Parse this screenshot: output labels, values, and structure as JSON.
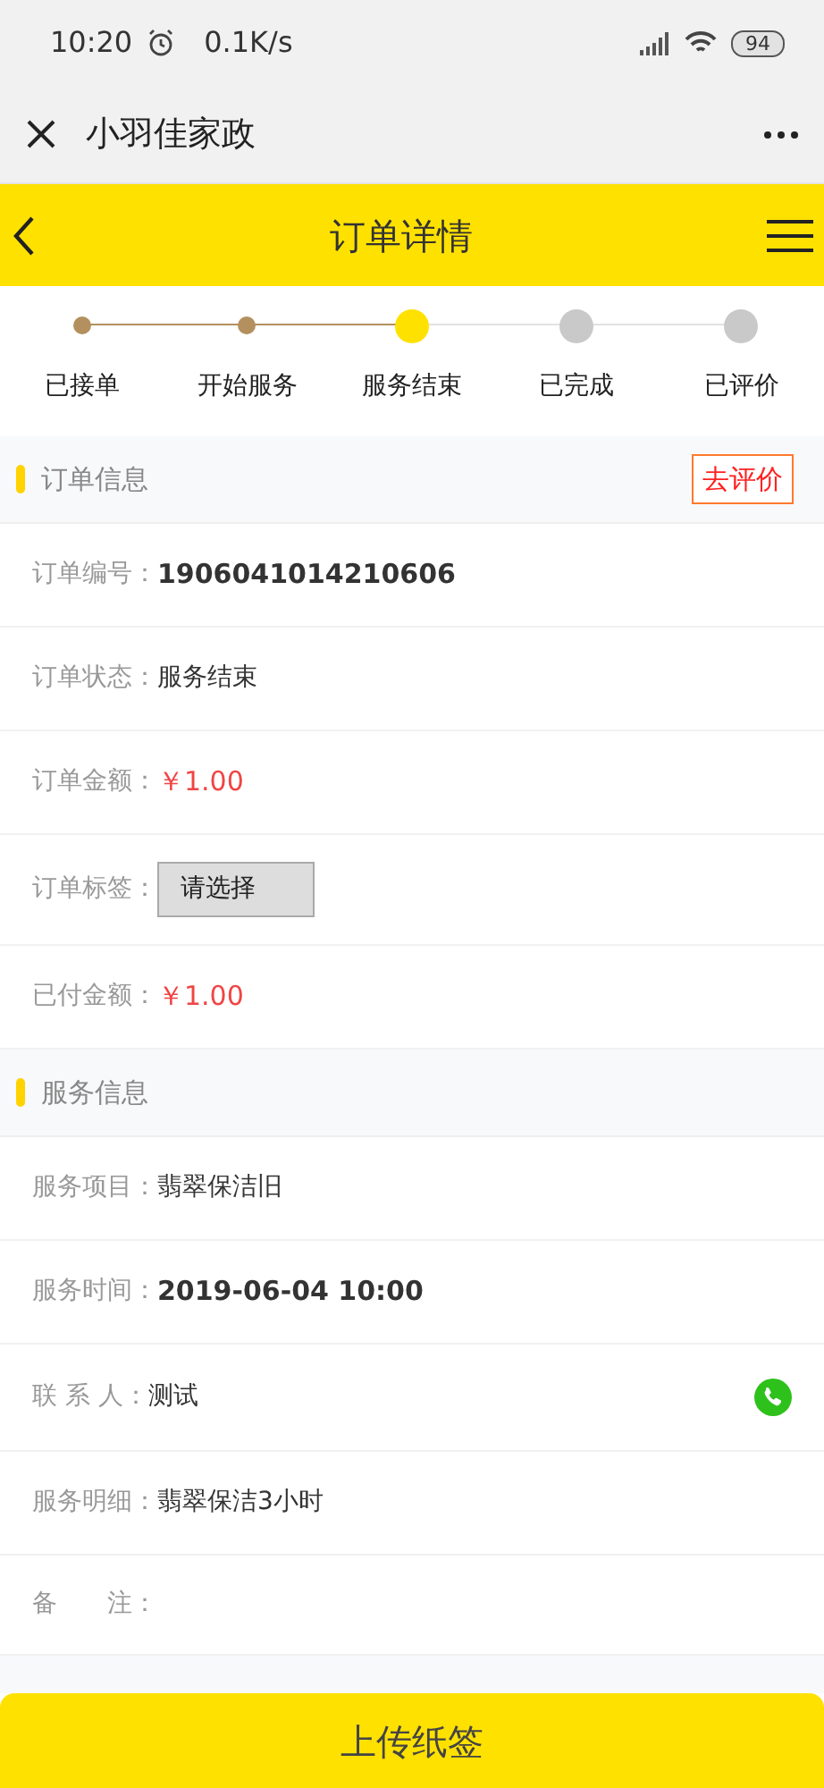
{
  "status_bar": {
    "time": "10:20",
    "speed": "0.1K/s",
    "battery": "94"
  },
  "app_bar": {
    "title": "小羽佳家政"
  },
  "header": {
    "title": "订单详情"
  },
  "steps": [
    {
      "label": "已接单",
      "done": true,
      "current": false
    },
    {
      "label": "开始服务",
      "done": true,
      "current": false
    },
    {
      "label": "服务结束",
      "done": false,
      "current": true
    },
    {
      "label": "已完成",
      "done": false,
      "current": false
    },
    {
      "label": "已评价",
      "done": false,
      "current": false
    }
  ],
  "sections": [
    {
      "title": "订单信息",
      "action": "去评价",
      "rows": [
        {
          "kind": "bold",
          "label": "订单编号：",
          "value": "1906041014210606"
        },
        {
          "kind": "text",
          "label": "订单状态：",
          "value": "服务结束"
        },
        {
          "kind": "price",
          "label": "订单金额：",
          "value": "￥1.00"
        },
        {
          "kind": "select",
          "label": "订单标签：",
          "value": "请选择"
        },
        {
          "kind": "price",
          "label": "已付金额：",
          "value": "￥1.00"
        }
      ]
    },
    {
      "title": "服务信息",
      "rows": [
        {
          "kind": "text",
          "label": "服务项目：",
          "value": "翡翠保洁旧"
        },
        {
          "kind": "bold",
          "label": "服务时间：",
          "value": "2019-06-04 10:00"
        },
        {
          "kind": "phone",
          "label": "联 系 人：",
          "value": "测试"
        },
        {
          "kind": "text",
          "label": "服务明细：",
          "value": "翡翠保洁3小时"
        },
        {
          "kind": "empty",
          "label": "备　　注："
        }
      ]
    }
  ],
  "bottom_button": "上传纸签"
}
